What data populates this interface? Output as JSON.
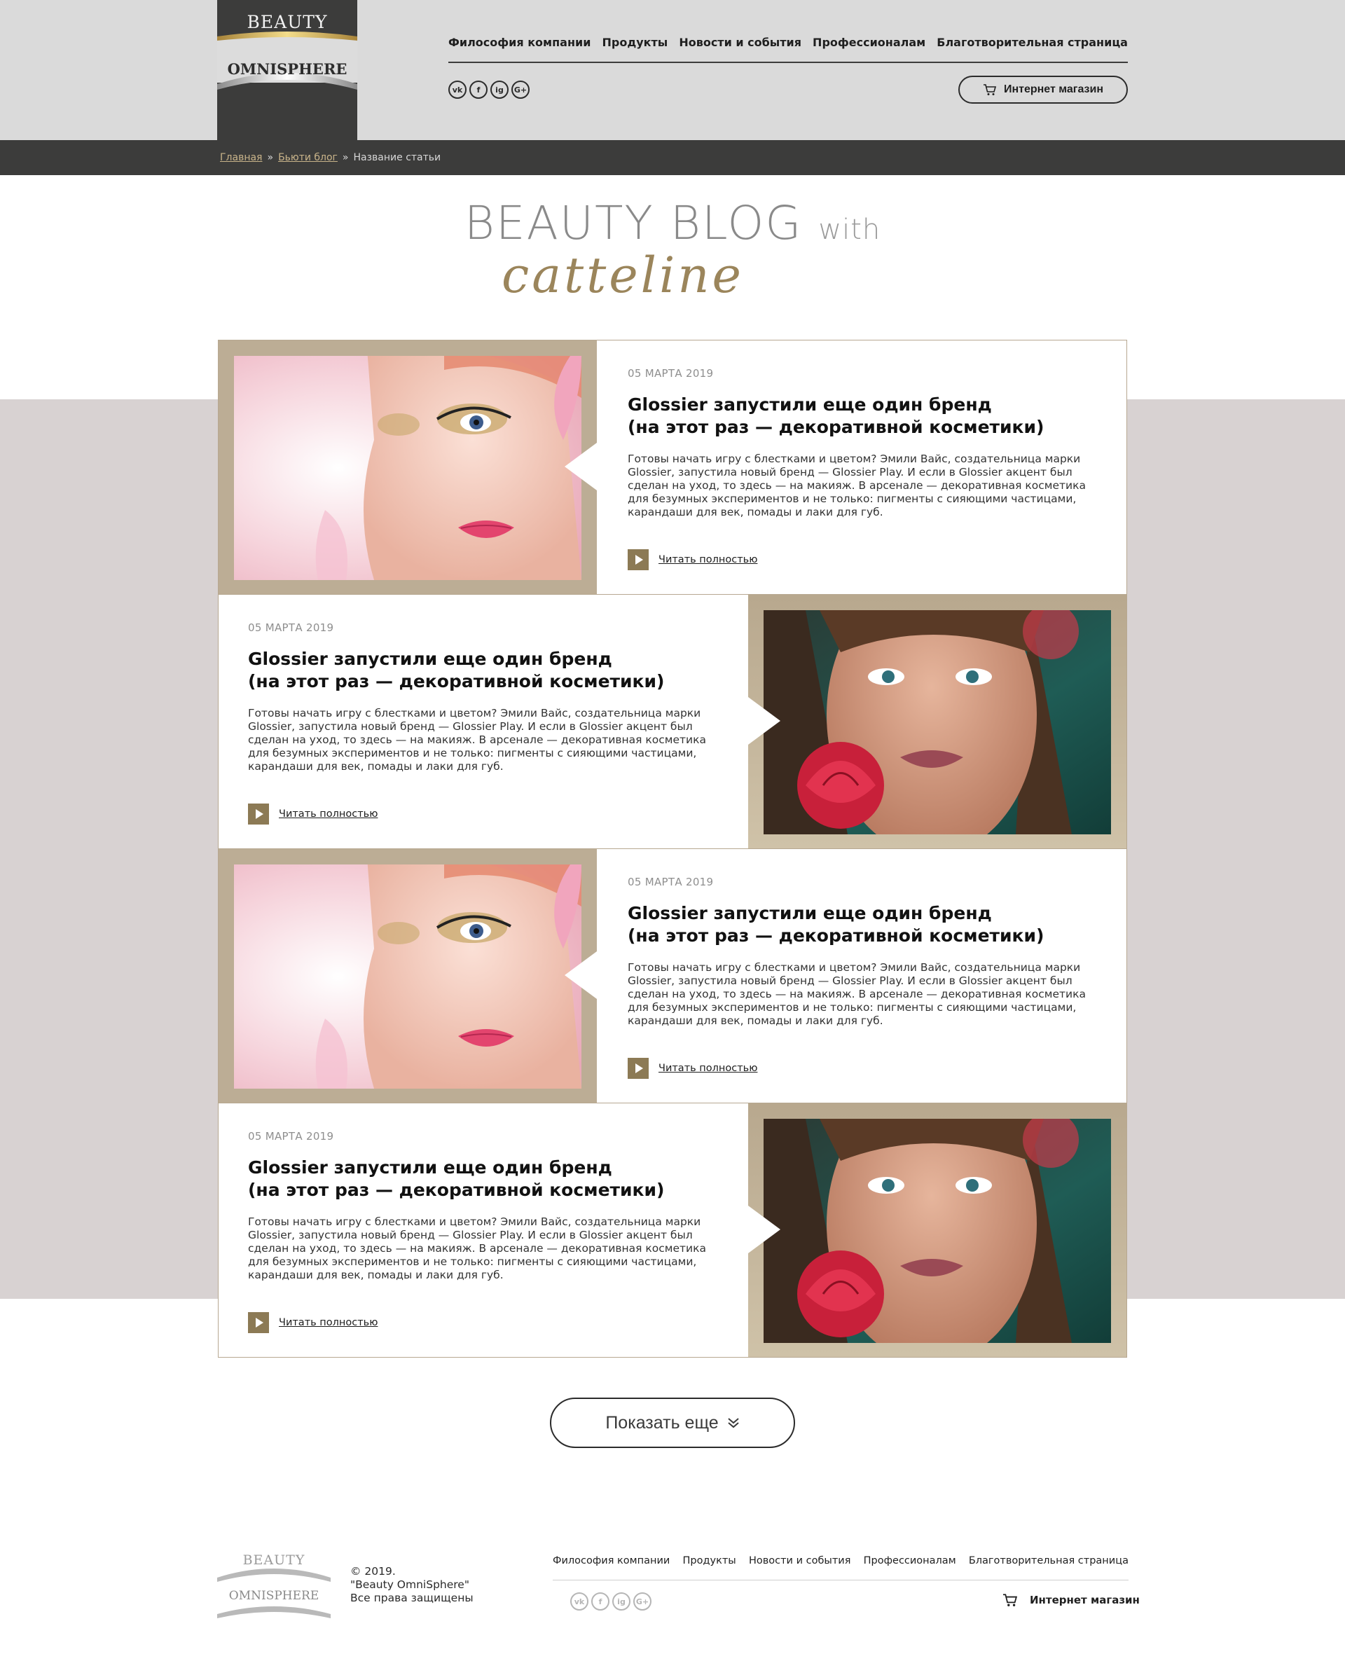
{
  "brand": {
    "top": "BEAUTY",
    "bottom": "OMNISPHERE"
  },
  "nav": [
    "Философия компании",
    "Продукты",
    "Новости и события",
    "Профессионалам",
    "Благотворительная страница"
  ],
  "social": [
    "vk",
    "f",
    "ig",
    "G+"
  ],
  "shop_label": "Интернет магазин",
  "breadcrumb": {
    "home": "Главная",
    "blog": "Бьюти блог",
    "current": "Название статьи",
    "sep": "»"
  },
  "blog_title": {
    "main": "BEAUTY BLOG",
    "with": "with",
    "signature": "catteline"
  },
  "posts": [
    {
      "date": "05 МАРТА 2019",
      "title_l1": "Glossier запустили еще один бренд",
      "title_l2": "(на этот раз — декоративной косметики)",
      "excerpt": "Готовы начать игру с блестками и цветом? Эмили Вайс, создательница марки Glossier, запустила новый бренд — Glossier Play. И если в Glossier акцент был сделан на уход, то здесь — на макияж. В арсенале — декоративная косметика для безумных экспериментов и не только: пигменты с сияющими частицами, карандаши для век, помады и лаки для губ.",
      "read": "Читать полностью"
    },
    {
      "date": "05 МАРТА 2019",
      "title_l1": "Glossier запустили еще один бренд",
      "title_l2": "(на этот раз — декоративной косметики)",
      "excerpt": "Готовы начать игру с блестками и цветом? Эмили Вайс, создательница марки Glossier, запустила новый бренд — Glossier Play. И если в Glossier акцент был сделан на уход, то здесь — на макияж. В арсенале — декоративная косметика для безумных экспериментов и не только: пигменты с сияющими частицами, карандаши для век, помады и лаки для губ.",
      "read": "Читать полностью"
    },
    {
      "date": "05 МАРТА 2019",
      "title_l1": "Glossier запустили еще один бренд",
      "title_l2": "(на этот раз — декоративной косметики)",
      "excerpt": "Готовы начать игру с блестками и цветом? Эмили Вайс, создательница марки Glossier, запустила новый бренд — Glossier Play. И если в Glossier акцент был сделан на уход, то здесь — на макияж. В арсенале — декоративная косметика для безумных экспериментов и не только: пигменты с сияющими частицами, карандаши для век, помады и лаки для губ.",
      "read": "Читать полностью"
    },
    {
      "date": "05 МАРТА 2019",
      "title_l1": "Glossier запустили еще один бренд",
      "title_l2": "(на этот раз — декоративной косметики)",
      "excerpt": "Готовы начать игру с блестками и цветом? Эмили Вайс, создательница марки Glossier, запустила новый бренд — Glossier Play. И если в Glossier акцент был сделан на уход, то здесь — на макияж. В арсенале — декоративная косметика для безумных экспериментов и не только: пигменты с сияющими частицами, карандаши для век, помады и лаки для губ.",
      "read": "Читать полностью"
    }
  ],
  "show_more": "Показать еще",
  "footer": {
    "brand_top": "BEAUTY",
    "brand_bottom": "OMNISPHERE",
    "copy_l1": "© 2019.",
    "copy_l2": "\"Beauty OmniSphere\"",
    "copy_l3": "Все права защищены",
    "nav": [
      "Философия компании",
      "Продукты",
      "Новости и события",
      "Профессионалам",
      "Благотворительная страница"
    ],
    "shop_label": "Интернет магазин"
  },
  "colors": {
    "header_bg": "#dadada",
    "dark": "#3c3c3b",
    "accent_gold": "#8c7a55",
    "frame": "#bcad95",
    "band": "#d8d2d2"
  }
}
